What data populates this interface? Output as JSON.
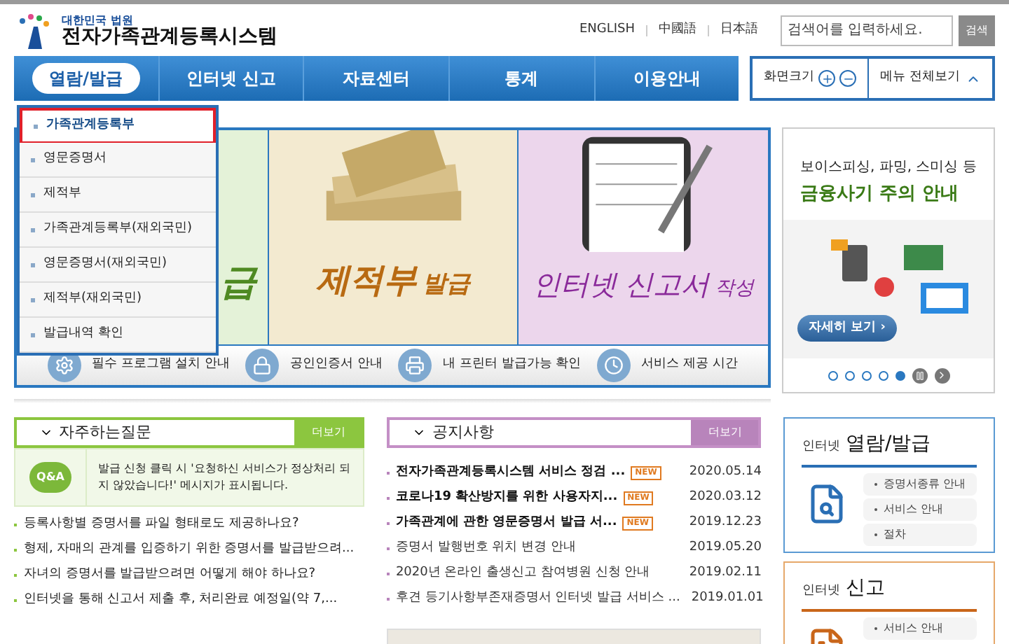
{
  "header": {
    "logo_tagline": "대한민국 법원",
    "logo_title": "전자가족관계등록시스템",
    "languages": [
      "ENGLISH",
      "中國語",
      "日本語"
    ],
    "search": {
      "placeholder": "검색어를 입력하세요.",
      "button": "검색"
    }
  },
  "nav": {
    "items": [
      {
        "label": "열람/발급",
        "selected": true
      },
      {
        "label": "인터넷 신고",
        "selected": false
      },
      {
        "label": "자료센터",
        "selected": false
      },
      {
        "label": "통계",
        "selected": false
      },
      {
        "label": "이용안내",
        "selected": false
      }
    ],
    "zoom_label": "화면크기",
    "menu_all": "메뉴 전체보기"
  },
  "dropdown": {
    "items": [
      {
        "label": "가족관계등록부",
        "selected": true
      },
      {
        "label": "영문증명서",
        "selected": false
      },
      {
        "label": "제적부",
        "selected": false
      },
      {
        "label": "가족관계등록부(재외국민)",
        "selected": false
      },
      {
        "label": "영문증명서(재외국민)",
        "selected": false
      },
      {
        "label": "제적부(재외국민)",
        "selected": false
      },
      {
        "label": "발급내역 확인",
        "selected": false
      }
    ]
  },
  "banner": {
    "panels": [
      {
        "kind": "green",
        "caption": "급"
      },
      {
        "kind": "books",
        "caption": "제적부",
        "caption_sub": "발급"
      },
      {
        "kind": "form",
        "caption": "인터넷 신고서",
        "caption_sub": "작성"
      }
    ],
    "links": [
      {
        "kind": "gear",
        "label": "필수 프로그램 설치 안내"
      },
      {
        "kind": "lock",
        "label": "공인인증서 안내"
      },
      {
        "kind": "printer",
        "label": "내 프린터 발급가능 확인"
      },
      {
        "kind": "clock",
        "label": "서비스 제공 시간"
      }
    ]
  },
  "promo": {
    "line1": "보이스피싱, 파밍, 스미싱 등",
    "line2": "금융사기 주의 안내",
    "button": "자세히 보기 ›",
    "dots": [
      {
        "selected": false
      },
      {
        "selected": false
      },
      {
        "selected": false
      },
      {
        "selected": false
      },
      {
        "selected": true
      }
    ]
  },
  "faq": {
    "title": "자주하는질문",
    "more": "더보기",
    "icon_text": "Q&A",
    "highlight": "발급 신청 클릭 시 '요청하신 서비스가 정상처리 되지 않았습니다!' 메시지가 표시됩니다.",
    "items": [
      "등록사항별 증명서를 파일 형태로도 제공하나요?",
      "형제, 자매의 관계를 입증하기 위한 증명서를 발급받으려...",
      "자녀의 증명서를 발급받으려면 어떻게 해야 하나요?",
      "인터넷을 통해 신고서 제출 후, 처리완료 예정일(약 7,..."
    ]
  },
  "notices": {
    "title": "공지사항",
    "more": "더보기",
    "items": [
      {
        "title": "전자가족관계등록시스템 서비스 정검 ...",
        "badge": "NEW",
        "date": "2020.05.14"
      },
      {
        "title": "코로나19 확산방지를 위한 사용자지...",
        "badge": "NEW",
        "date": "2020.03.12"
      },
      {
        "title": "가족관계에 관한 영문증명서 발급 서...",
        "badge": "NEW",
        "date": "2019.12.23"
      },
      {
        "title": "증명서 발행번호 위치 변경 안내",
        "date": "2019.05.20"
      },
      {
        "title": "2020년 온라인 출생신고 참여병원 신청 안내",
        "date": "2019.02.11"
      },
      {
        "title": "후견 등기사항부존재증명서 인터넷 발급 서비스 ...",
        "date": "2019.01.01"
      }
    ]
  },
  "side_boxes": [
    {
      "kind": "view",
      "prefix": "인터넷",
      "title": "열람/발급",
      "links": [
        "증명서종류 안내",
        "서비스 안내",
        "절차"
      ]
    },
    {
      "kind": "report",
      "prefix": "인터넷",
      "title": "신고",
      "links": [
        "서비스 안내"
      ]
    }
  ]
}
